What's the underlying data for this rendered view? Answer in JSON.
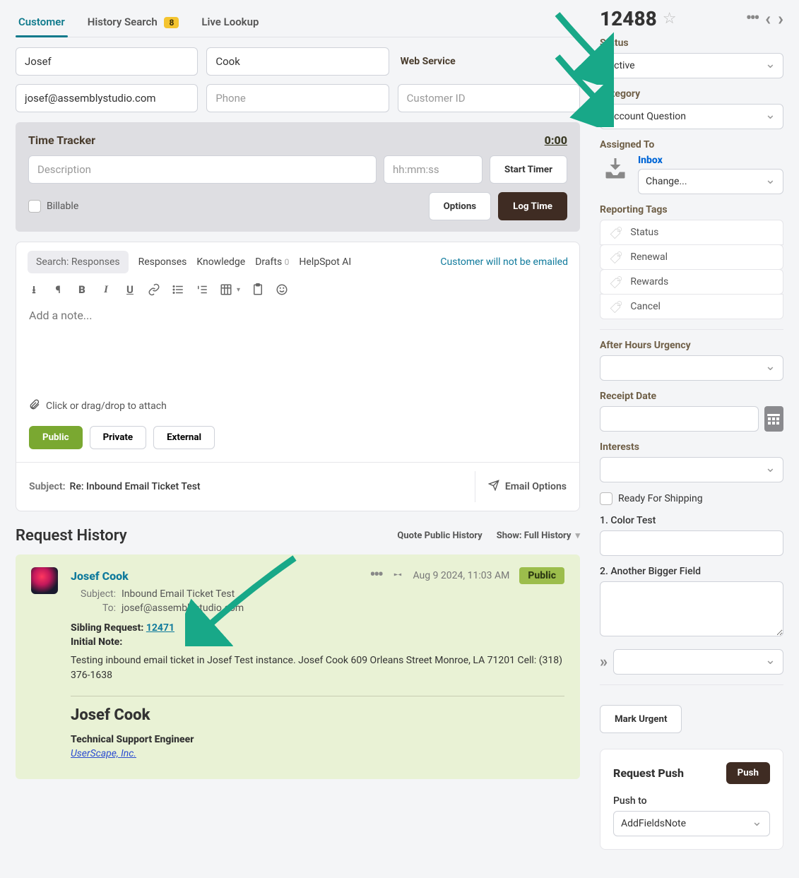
{
  "tabs": {
    "customer": "Customer",
    "history": "History Search",
    "history_badge": "8",
    "live": "Live Lookup"
  },
  "customer_form": {
    "first_name": "Josef",
    "last_name": "Cook",
    "web_service_label": "Web Service",
    "email": "josef@assemblystudio.com",
    "phone_ph": "Phone",
    "cust_id_ph": "Customer ID"
  },
  "time_tracker": {
    "title": "Time Tracker",
    "elapsed": "0:00",
    "desc_ph": "Description",
    "hms_ph": "hh:mm:ss",
    "start": "Start Timer",
    "billable": "Billable",
    "options": "Options",
    "log": "Log Time"
  },
  "editor": {
    "search_ph": "Search: Responses",
    "tab_responses": "Responses",
    "tab_knowledge": "Knowledge",
    "tab_drafts": "Drafts",
    "drafts_count": "0",
    "tab_ai": "HelpSpot AI",
    "no_email_note": "Customer will not be emailed",
    "note_ph": "Add a note...",
    "attach": "Click or drag/drop to attach",
    "vis_public": "Public",
    "vis_private": "Private",
    "vis_external": "External",
    "subject_lbl": "Subject:",
    "subject_val": "Re: Inbound Email Ticket Test",
    "email_options": "Email Options"
  },
  "request_history": {
    "title": "Request History",
    "quote": "Quote Public History",
    "show_label": "Show: Full History",
    "entry": {
      "name": "Josef Cook",
      "timestamp": "Aug 9 2024, 11:03 AM",
      "badge": "Public",
      "subject_lbl": "Subject:",
      "subject_val": "Inbound Email Ticket Test",
      "to_lbl": "To:",
      "to_val": "josef@assemblystudio.com",
      "sibling_lbl": "Sibling Request:",
      "sibling_link": "12471",
      "initial_lbl": "Initial Note:",
      "note_text": "Testing inbound email ticket in Josef Test instance. Josef Cook 609 Orleans Street Monroe, LA 71201 Cell: (318) 376-1638",
      "sig_name": "Josef Cook",
      "sig_title": "Technical Support Engineer",
      "sig_company": "UserScape, Inc."
    }
  },
  "ticket": {
    "id": "12488",
    "status_lbl": "Status",
    "status_val": "Active",
    "category_lbl": "Category",
    "category_val": "Account Question",
    "assigned_lbl": "Assigned To",
    "assigned_inbox": "Inbox",
    "assigned_change": "Change...",
    "tags_lbl": "Reporting Tags",
    "tags": {
      "t0": "Status",
      "t1": "Renewal",
      "t2": "Rewards",
      "t3": "Cancel"
    },
    "urgency_lbl": "After Hours Urgency",
    "receipt_lbl": "Receipt Date",
    "interests_lbl": "Interests",
    "ready_lbl": "Ready For Shipping",
    "color_lbl": "1. Color Test",
    "bigger_lbl": "2. Another Bigger Field",
    "mark_urgent": "Mark Urgent"
  },
  "push": {
    "title": "Request Push",
    "btn": "Push",
    "push_to_lbl": "Push to",
    "push_to_val": "AddFieldsNote"
  }
}
